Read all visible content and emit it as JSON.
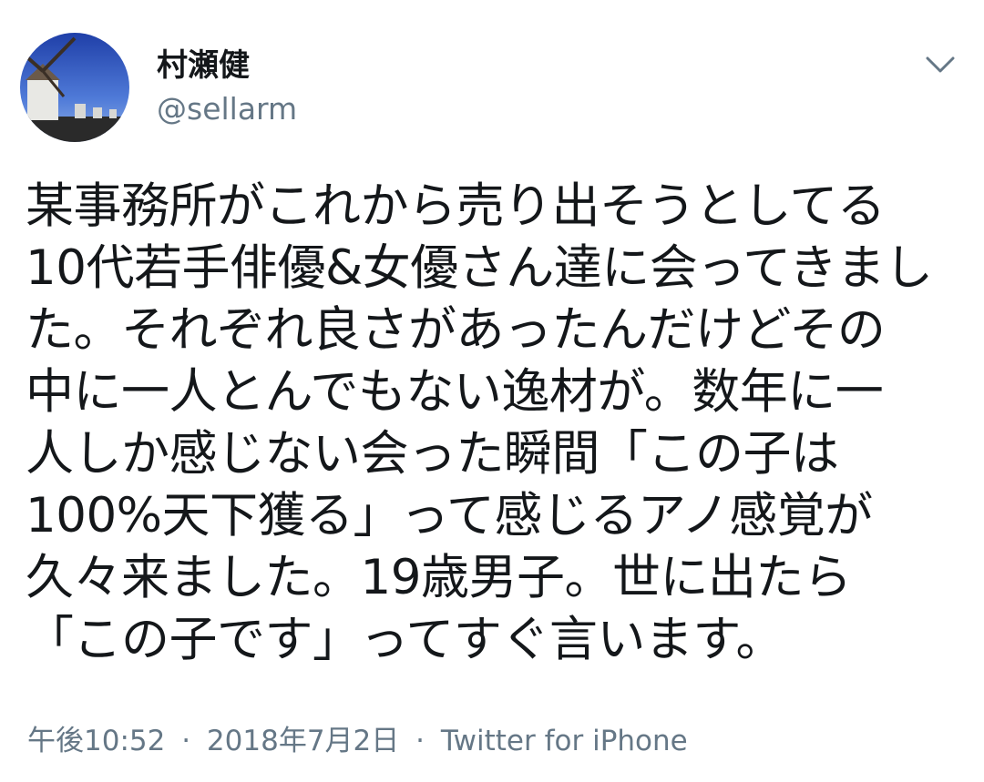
{
  "user": {
    "display_name": "村瀬健",
    "handle": "@sellarm"
  },
  "menu": {
    "icon": "chevron-down-icon"
  },
  "tweet": {
    "lines": [
      "某事務所がこれから売り出そうとしてる",
      "10代若手俳優&女優さん達に会ってきまし",
      "た。それぞれ良さがあったんだけどその",
      "中に一人とんでもない逸材が。数年に一",
      "人しか感じない会った瞬間「この子は",
      "100%天下獲る」って感じるアノ感覚が",
      "久々来ました。19歳男子。世に出たら",
      "「この子です」ってすぐ言います。"
    ]
  },
  "meta": {
    "time": "午後10:52",
    "separator": "·",
    "date": "2018年7月2日",
    "source": "Twitter for iPhone"
  },
  "colors": {
    "text": "#14171a",
    "secondary": "#657786"
  }
}
